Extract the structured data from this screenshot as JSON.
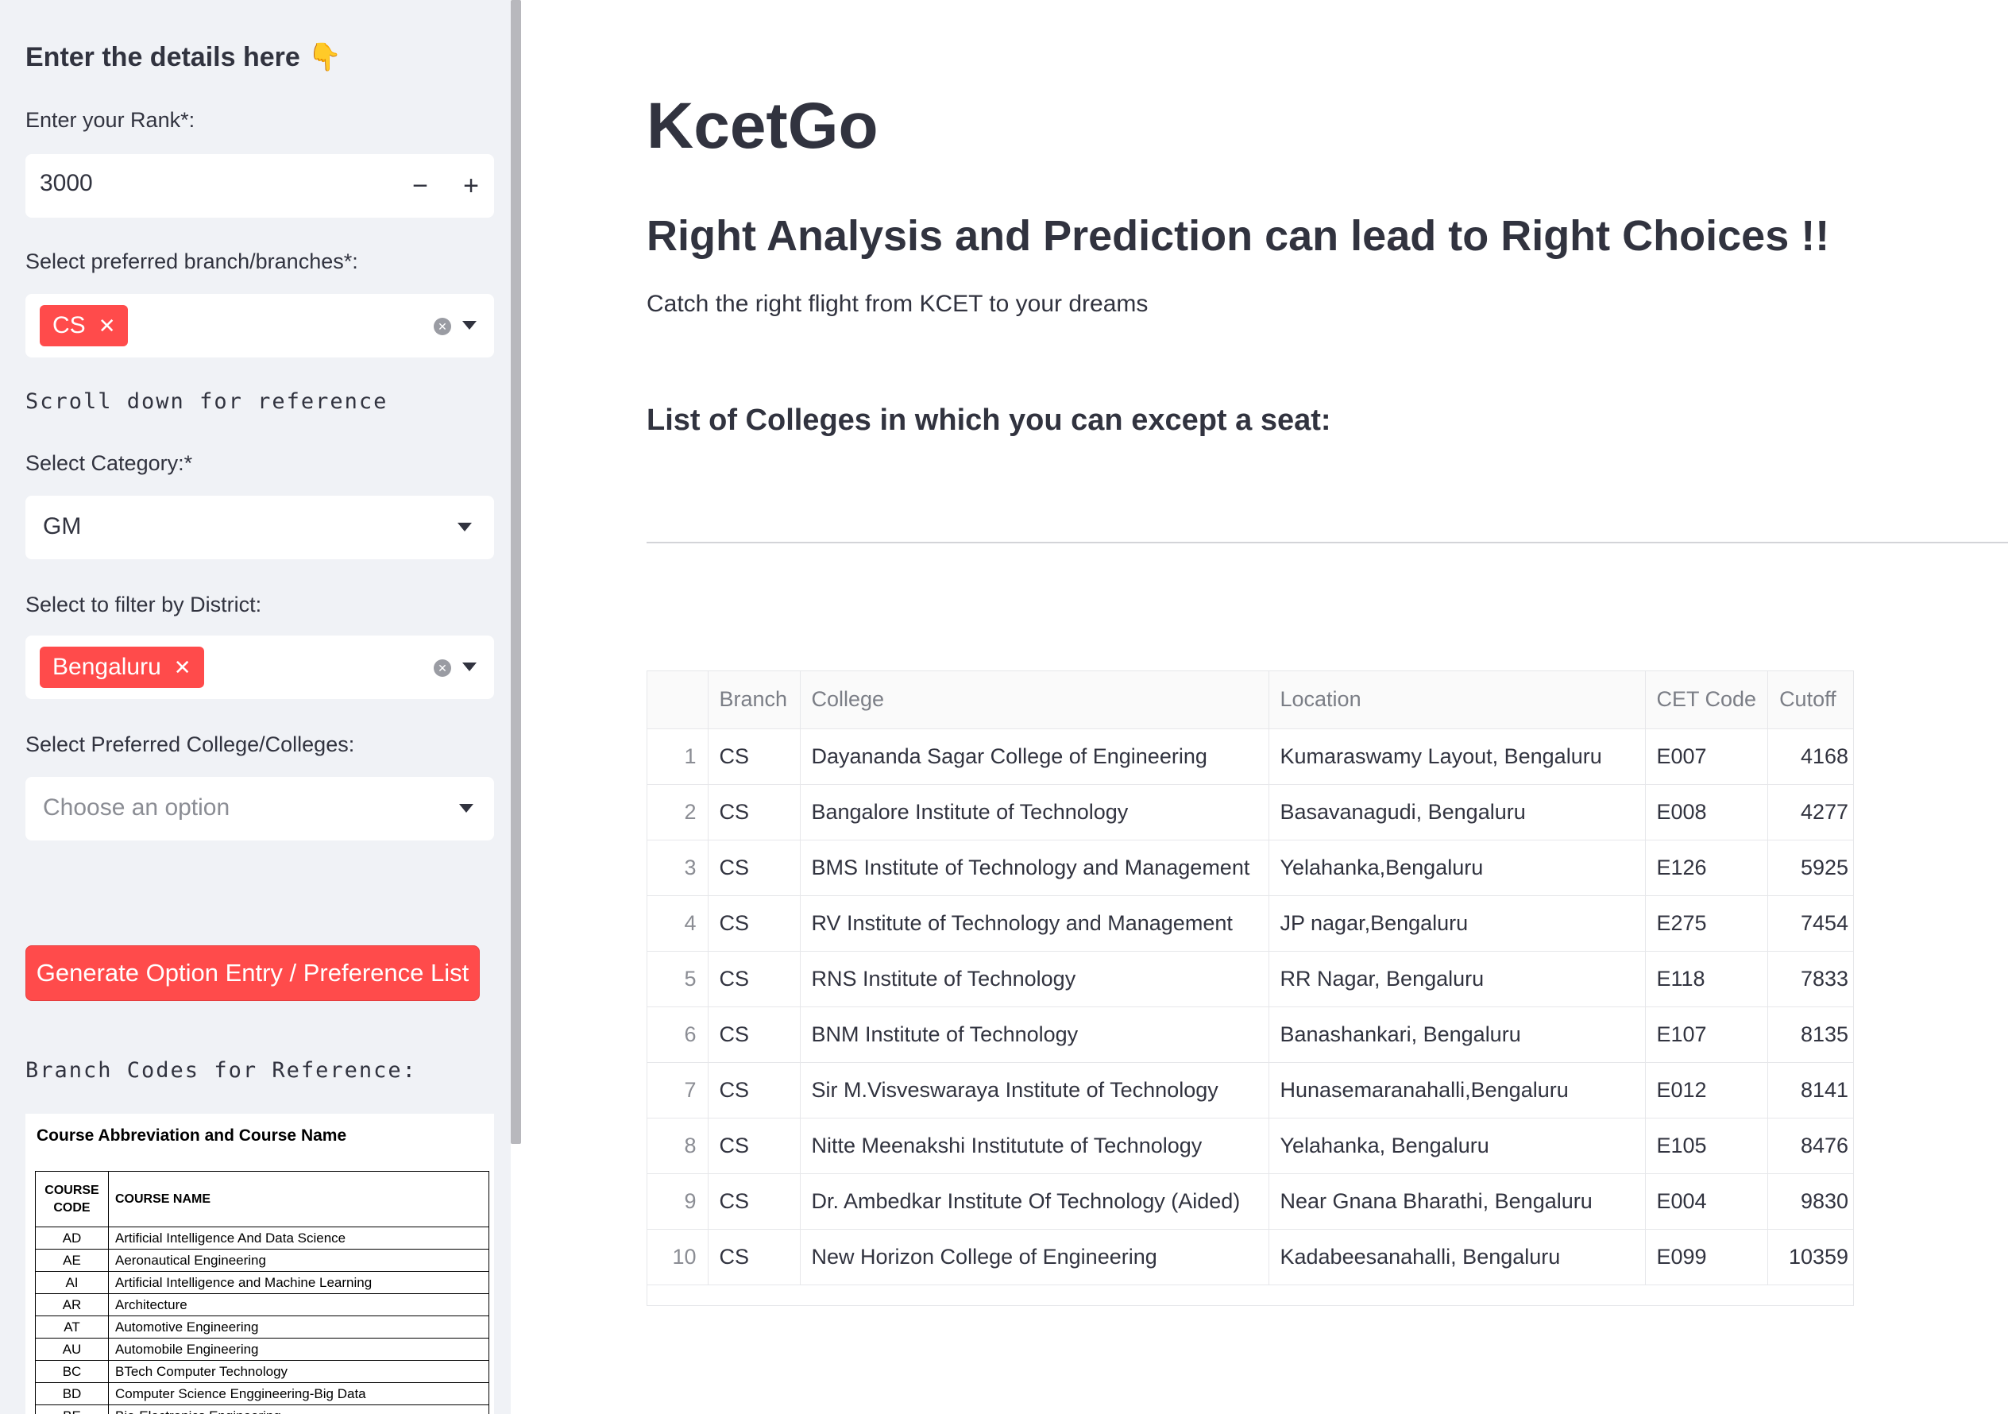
{
  "sidebar": {
    "heading": "Enter the details here",
    "heading_emoji": "👇",
    "rank_label": "Enter your Rank*:",
    "rank_value": "3000",
    "minus_label": "−",
    "plus_label": "+",
    "branch_label": "Select preferred branch/branches*:",
    "branch_tag": "CS",
    "scroll_note": "Scroll down for reference",
    "category_label": "Select Category:*",
    "category_value": "GM",
    "district_label": "Select to filter by District:",
    "district_tag": "Bengaluru",
    "college_label": "Select Preferred College/Colleges:",
    "college_placeholder": "Choose an option",
    "generate_button": "Generate Option Entry / Preference List",
    "ref_heading": "Branch Codes for Reference:",
    "ref_image": {
      "title": "Course Abbreviation and Course Name",
      "col_code": "COURSE CODE",
      "col_name": "COURSE NAME",
      "rows": [
        {
          "code": "AD",
          "name": "Artificial Intelligence And Data Science"
        },
        {
          "code": "AE",
          "name": "Aeronautical Engineering"
        },
        {
          "code": "AI",
          "name": "Artificial Intelligence and Machine Learning"
        },
        {
          "code": "AR",
          "name": "Architecture"
        },
        {
          "code": "AT",
          "name": "Automotive Engineering"
        },
        {
          "code": "AU",
          "name": "Automobile  Engineering"
        },
        {
          "code": "BC",
          "name": "BTech Computer Technology"
        },
        {
          "code": "BD",
          "name": "Computer Science Enggineering-Big Data"
        },
        {
          "code": "BE",
          "name": "Bio-Electronics Engineering"
        }
      ]
    }
  },
  "main": {
    "title": "KcetGo",
    "subtitle": "Right Analysis and Prediction can lead to Right Choices !!",
    "tagline": "Catch the right flight from KCET to your dreams",
    "list_heading": "List of Colleges in which you can except a seat:",
    "table": {
      "columns": [
        "",
        "Branch",
        "College",
        "Location",
        "CET Code",
        "Cutoff"
      ],
      "rows": [
        {
          "idx": "1",
          "branch": "CS",
          "college": "Dayananda Sagar College of Engineering",
          "location": "Kumaraswamy Layout, Bengaluru",
          "code": "E007",
          "cutoff": "4168"
        },
        {
          "idx": "2",
          "branch": "CS",
          "college": "Bangalore Institute of Technology",
          "location": "Basavanagudi, Bengaluru",
          "code": "E008",
          "cutoff": "4277"
        },
        {
          "idx": "3",
          "branch": "CS",
          "college": "BMS Institute of Technology and Management",
          "location": "Yelahanka,Bengaluru",
          "code": "E126",
          "cutoff": "5925"
        },
        {
          "idx": "4",
          "branch": "CS",
          "college": "RV Institute of Technology and Management",
          "location": "JP nagar,Bengaluru",
          "code": "E275",
          "cutoff": "7454"
        },
        {
          "idx": "5",
          "branch": "CS",
          "college": "RNS Institute of Technology",
          "location": "RR Nagar, Bengaluru",
          "code": "E118",
          "cutoff": "7833"
        },
        {
          "idx": "6",
          "branch": "CS",
          "college": "BNM Institute of Technology",
          "location": "Banashankari, Bengaluru",
          "code": "E107",
          "cutoff": "8135"
        },
        {
          "idx": "7",
          "branch": "CS",
          "college": "Sir M.Visveswaraya Institute of Technology",
          "location": "Hunasemaranahalli,Bengaluru",
          "code": "E012",
          "cutoff": "8141"
        },
        {
          "idx": "8",
          "branch": "CS",
          "college": "Nitte Meenakshi Institutute of Technology",
          "location": "Yelahanka, Bengaluru",
          "code": "E105",
          "cutoff": "8476"
        },
        {
          "idx": "9",
          "branch": "CS",
          "college": "Dr. Ambedkar Institute Of Technology (Aided)",
          "location": "Near Gnana Bharathi, Bengaluru",
          "code": "E004",
          "cutoff": "9830"
        },
        {
          "idx": "10",
          "branch": "CS",
          "college": "New Horizon College of Engineering",
          "location": "Kadabeesanahalli, Bengaluru",
          "code": "E099",
          "cutoff": "10359"
        }
      ]
    }
  },
  "colors": {
    "primary": "#ff4b4b",
    "sidebar_bg": "#f0f2f6",
    "text": "#31333f"
  }
}
